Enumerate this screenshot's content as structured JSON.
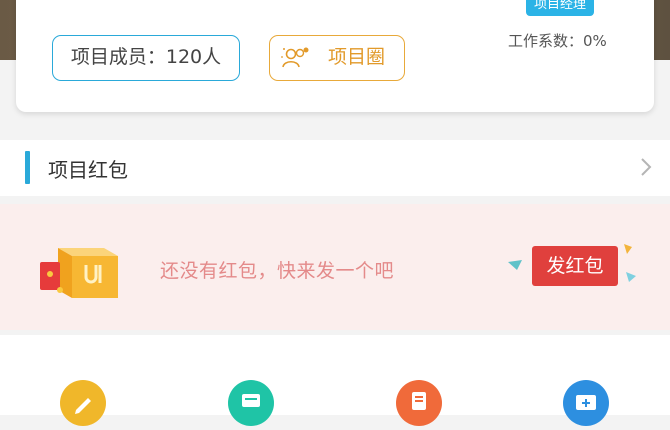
{
  "project_card": {
    "role_badge": "项目经理",
    "work_coefficient": "工作系数：0%",
    "members_button": "项目成员：120人",
    "circle_button": "项目圈"
  },
  "red_packet_section": {
    "title": "项目红包"
  },
  "red_packet_banner": {
    "empty_text": "还没有红包，快来发一个吧",
    "send_button": "发红包"
  },
  "colors": {
    "accent_blue": "#2aa9d9",
    "accent_orange": "#e8a93a",
    "red": "#e0403d",
    "banner_bg": "#fbeeed"
  },
  "function_icons": [
    {
      "name": "edit-icon",
      "color": "#f0b72a"
    },
    {
      "name": "message-icon",
      "color": "#1fc4a6"
    },
    {
      "name": "document-icon",
      "color": "#f06a3a"
    },
    {
      "name": "folder-add-icon",
      "color": "#2d8fe0"
    }
  ]
}
